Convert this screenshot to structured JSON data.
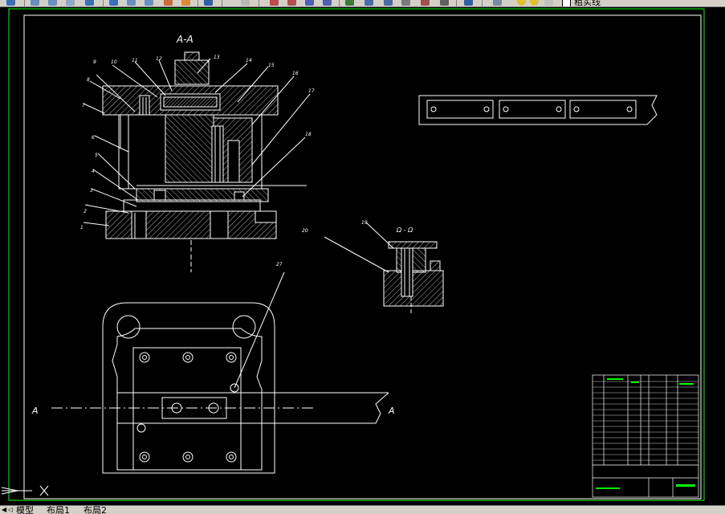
{
  "toolbar": {
    "linetype_label": "粗实线",
    "buttons": [
      "save-icon",
      "plot-icon",
      "preview-icon",
      "publish-icon",
      "undo-icon",
      "redo-icon",
      "pan-icon",
      "zoom-realtime-icon",
      "zoom-window-icon",
      "zoom-previous-icon",
      "properties-icon",
      "designcenter-icon",
      "toolpalette-icon",
      "sheetset-icon",
      "markup-icon",
      "calculator-icon",
      "help-icon",
      "layer-icon",
      "layer-state-icon",
      "layer-previous-icon"
    ]
  },
  "drawing": {
    "section_label": "A-A",
    "view_label": "Ω - Ω",
    "cut_left": "A",
    "cut_right": "A",
    "part_numbers": [
      "1",
      "2",
      "3",
      "4",
      "5",
      "6",
      "7",
      "8",
      "9",
      "10",
      "11",
      "12",
      "13",
      "14",
      "15",
      "16",
      "17",
      "18",
      "19",
      "20",
      "27"
    ]
  },
  "tabs": {
    "items": [
      "模型",
      "布局1",
      "布局2"
    ],
    "active": "模型"
  },
  "colors": {
    "background": "#000000",
    "lines": "#ffffff",
    "frame": "#00ff00",
    "title_text": "#00ff00",
    "hatch": "#ffffff",
    "chrome": "#d4d0c8"
  }
}
